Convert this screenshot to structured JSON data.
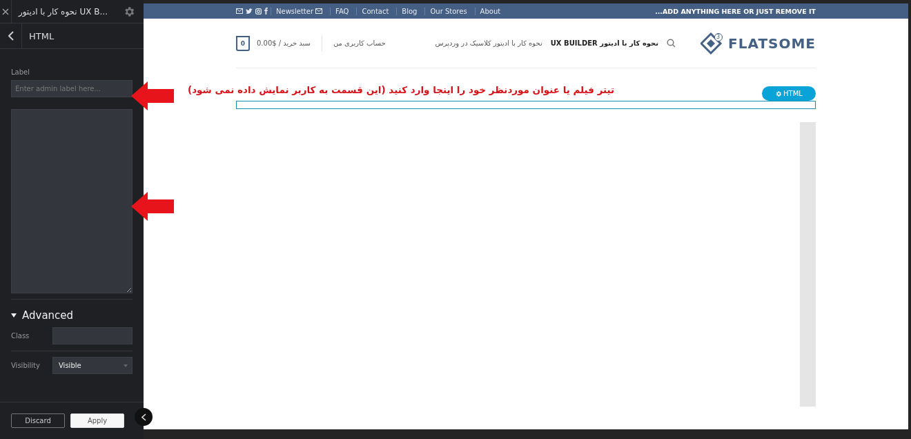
{
  "sidebar": {
    "title": "نحوه کار با ادیتور UX B...",
    "section": "HTML",
    "label_field": {
      "label": "Label",
      "placeholder": "Enter admin label here..."
    },
    "advanced": {
      "title": "Advanced",
      "expanded": true
    },
    "class_field": {
      "label": "Class"
    },
    "visibility_field": {
      "label": "Visibility",
      "value": "Visible"
    },
    "buttons": [
      {
        "label": "Discard",
        "kind": "secondary"
      },
      {
        "label": "Apply",
        "kind": "primary"
      }
    ]
  },
  "top_bar": {
    "links": [
      "Newsletter",
      "FAQ",
      "Contact",
      "Blog",
      "Our Stores",
      "About"
    ],
    "promo": "...ADD ANYTHING HERE OR JUST REMOVE IT"
  },
  "header": {
    "logo": "FLATSOME",
    "logo_badge": "3",
    "nav": [
      {
        "label": "نحوه کار با ادیتور UX BUILDER",
        "bold": true
      },
      {
        "label": "نحوه کار با ادیتور کلاسیک در وردپرس",
        "bold": false
      }
    ],
    "account": "حساب کاربری من",
    "cart": "سبد خرید / $0.00",
    "cart_count": "0"
  },
  "element": {
    "label": "HTML"
  },
  "annotation": "تیتر فیلم یا عنوان موردنظر خود را اینجا وارد کنید (این قسمت به کاربر نمایش داده نمی شود)"
}
